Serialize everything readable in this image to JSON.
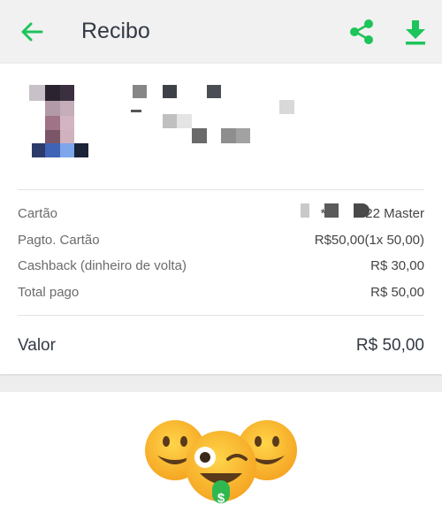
{
  "header": {
    "title": "Recibo",
    "back_icon": "arrow-left-icon",
    "share_icon": "share-icon",
    "download_icon": "download-icon",
    "accent_color": "#1dc45a"
  },
  "details": [
    {
      "label": "Cartão",
      "value": "***        22 Master"
    },
    {
      "label": "Pagto. Cartão",
      "value": "R$50,00(1x 50,00)"
    },
    {
      "label": "Cashback (dinheiro de volta)",
      "value": "R$ 30,00"
    },
    {
      "label": "Total pago",
      "value": "R$ 50,00"
    }
  ],
  "total": {
    "label": "Valor",
    "value": "R$ 50,00"
  },
  "footer": {
    "illustration": "emoji-cashback-illustration",
    "dollar_badge": "$"
  }
}
